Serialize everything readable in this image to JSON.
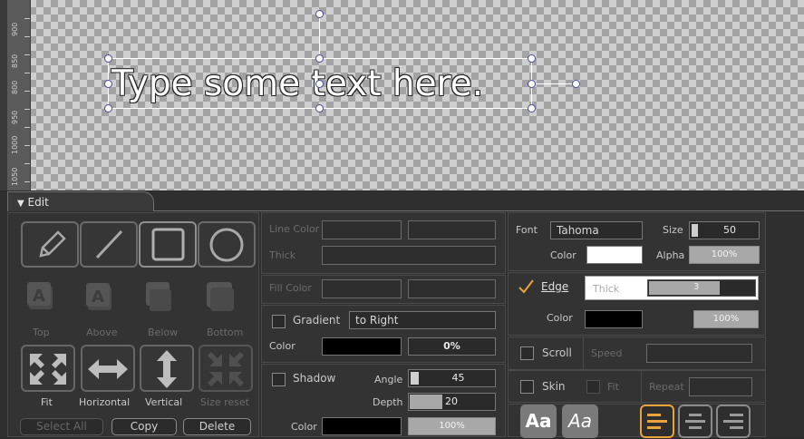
{
  "canvas": {
    "sample_text": "Type some text here.",
    "ruler_ticks": [
      "900",
      "850",
      "800",
      "950",
      "1000",
      "1050"
    ]
  },
  "panel": {
    "tab_label": "Edit",
    "tools": {
      "top": "Top",
      "above": "Above",
      "below": "Below",
      "bottom": "Bottom",
      "fit": "Fit",
      "horizontal": "Horizontal",
      "vertical": "Vertical",
      "size_reset": "Size reset"
    },
    "buttons": {
      "select_all": "Select All",
      "copy": "Copy",
      "delete": "Delete"
    },
    "line": {
      "color_label": "Line Color",
      "thick_label": "Thick"
    },
    "fill": {
      "color_label": "Fill Color"
    },
    "gradient": {
      "label": "Gradient",
      "direction": "to Right",
      "color_label": "Color",
      "percent": "0%"
    },
    "shadow": {
      "label": "Shadow",
      "angle_label": "Angle",
      "angle": "45",
      "depth_label": "Depth",
      "depth": "20",
      "color_label": "Color",
      "percent": "100%"
    },
    "font": {
      "label": "Font",
      "family": "Tahoma",
      "size_label": "Size",
      "size": "50",
      "color_label": "Color",
      "alpha_label": "Alpha",
      "alpha": "100%"
    },
    "edge": {
      "label": "Edge",
      "thick_label": "Thick",
      "thick": "3",
      "color_label": "Color",
      "percent": "100%"
    },
    "scroll": {
      "label": "Scroll",
      "speed_label": "Speed"
    },
    "skin": {
      "label": "Skin",
      "fit_label": "Fit",
      "repeat_label": "Repeat"
    },
    "style_buttons": {
      "bold": "Aa",
      "italic": "Aa"
    },
    "colors": {
      "accent": "#e8a33a",
      "panel_bg": "#2f2f2f"
    }
  }
}
